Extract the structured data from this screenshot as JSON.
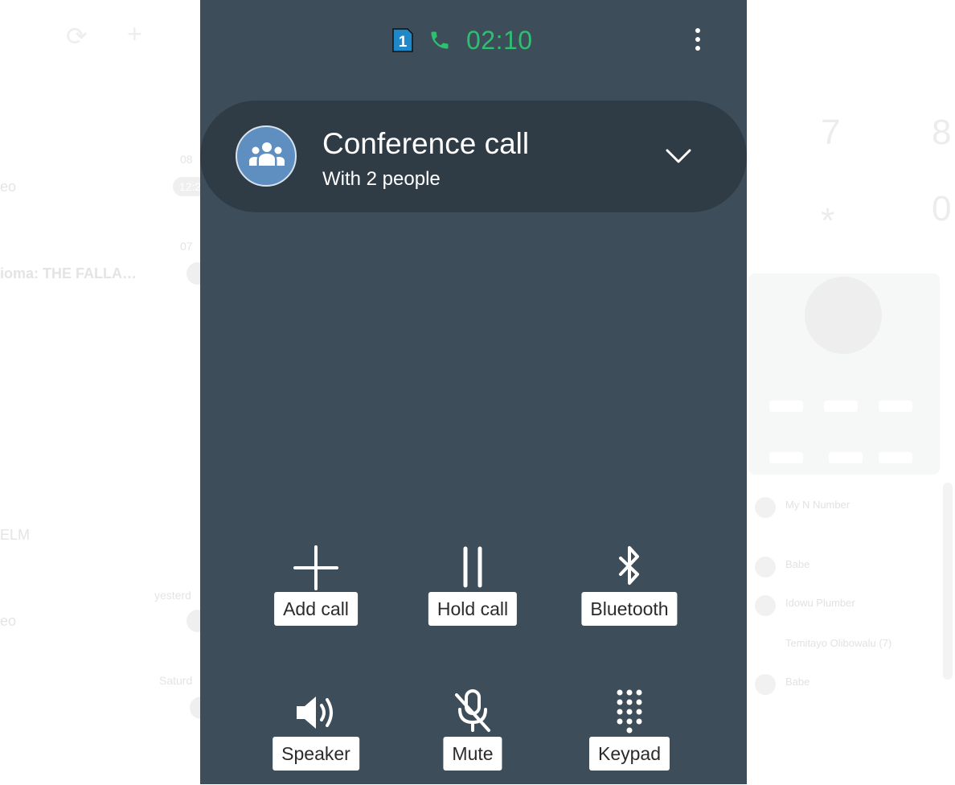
{
  "background": {
    "left_texts": [
      "eo",
      "ioma: THE FALLA…",
      "ELM",
      "eo",
      "Saturd",
      "yesterd",
      "07",
      "08"
    ],
    "left_pill": "12:2",
    "right_digits": [
      "7",
      "8",
      "*",
      "0"
    ],
    "right_contacts": [
      "My N Number",
      "Babe",
      "Idowu Plumber",
      "Temitayo Olibowalu (7)",
      "Babe"
    ]
  },
  "status_bar": {
    "sim_label": "1",
    "call_timer": "02:10",
    "timer_color": "#2fbf71"
  },
  "conference": {
    "title": "Conference call",
    "subtitle": "With 2 people"
  },
  "controls": [
    {
      "label": "Add call",
      "icon": "plus-icon"
    },
    {
      "label": "Hold call",
      "icon": "pause-icon"
    },
    {
      "label": "Bluetooth",
      "icon": "bluetooth-icon"
    },
    {
      "label": "Speaker",
      "icon": "speaker-icon"
    },
    {
      "label": "Mute",
      "icon": "mic-off-icon"
    },
    {
      "label": "Keypad",
      "icon": "keypad-icon"
    }
  ],
  "colors": {
    "screen_bg": "#3d4d59",
    "card_bg": "#2f3c45",
    "avatar_bg": "#5f8fc0"
  }
}
